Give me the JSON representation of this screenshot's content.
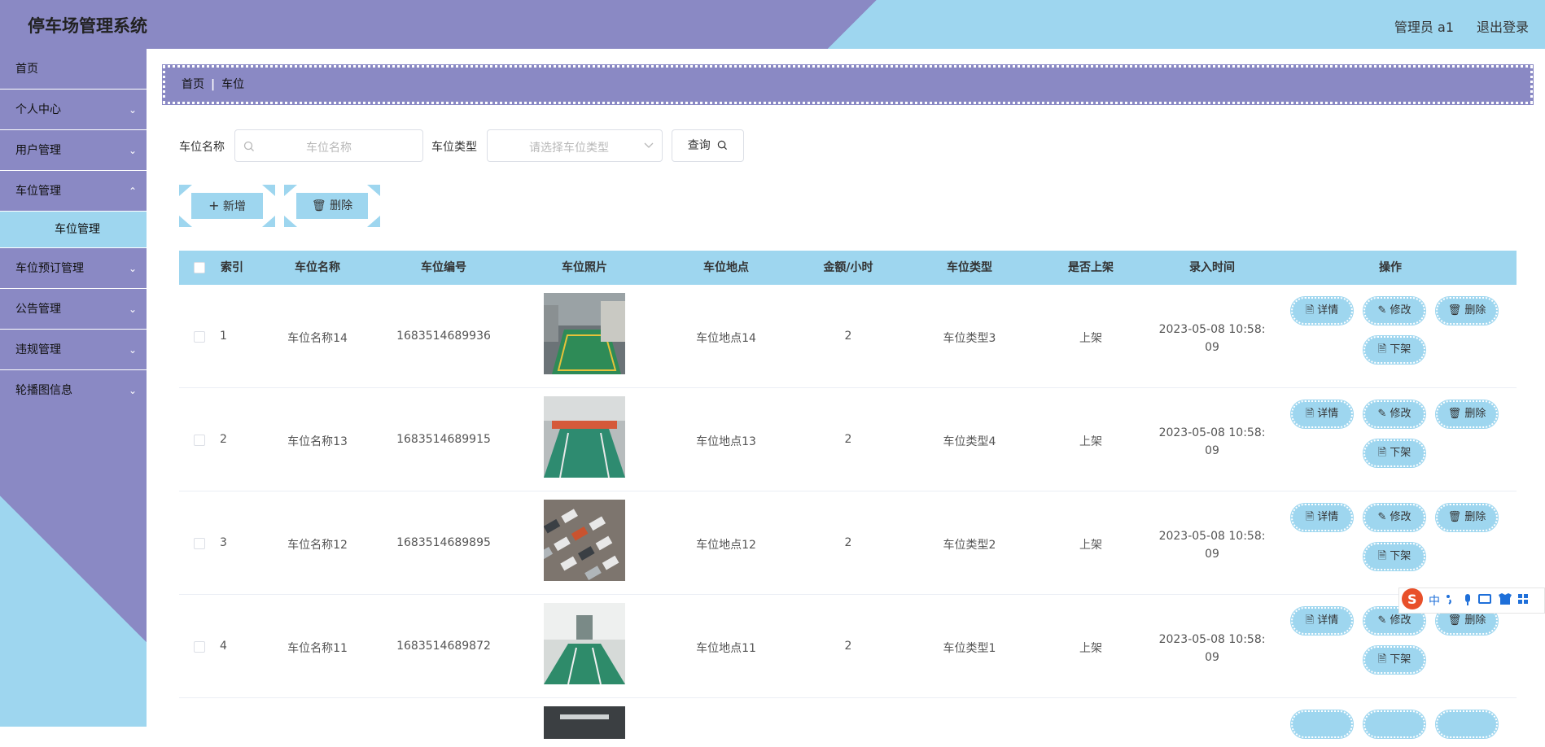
{
  "header": {
    "title": "停车场管理系统",
    "user": "管理员 a1",
    "logout": "退出登录"
  },
  "sidebar": {
    "items": [
      {
        "label": "首页"
      },
      {
        "label": "个人中心"
      },
      {
        "label": "用户管理"
      },
      {
        "label": "车位管理"
      },
      {
        "label": "车位预订管理"
      },
      {
        "label": "公告管理"
      },
      {
        "label": "违规管理"
      },
      {
        "label": "轮播图信息"
      }
    ],
    "sub_item": "车位管理"
  },
  "breadcrumb": {
    "home": "首页",
    "separator": "|",
    "current": "车位"
  },
  "search": {
    "name_label": "车位名称",
    "name_placeholder": "车位名称",
    "type_label": "车位类型",
    "type_placeholder": "请选择车位类型",
    "query_button": "查询"
  },
  "actions": {
    "add": "新增",
    "delete": "删除"
  },
  "table": {
    "headers": [
      "索引",
      "车位名称",
      "车位编号",
      "车位照片",
      "车位地点",
      "金额/小时",
      "车位类型",
      "是否上架",
      "录入时间",
      "操作"
    ],
    "rows": [
      {
        "index": "1",
        "name": "车位名称14",
        "code": "1683514689936",
        "location": "车位地点14",
        "price": "2",
        "type": "车位类型3",
        "status": "上架",
        "time_line1": "2023-05-08 10:58:",
        "time_line2": "09"
      },
      {
        "index": "2",
        "name": "车位名称13",
        "code": "1683514689915",
        "location": "车位地点13",
        "price": "2",
        "type": "车位类型4",
        "status": "上架",
        "time_line1": "2023-05-08 10:58:",
        "time_line2": "09"
      },
      {
        "index": "3",
        "name": "车位名称12",
        "code": "1683514689895",
        "location": "车位地点12",
        "price": "2",
        "type": "车位类型2",
        "status": "上架",
        "time_line1": "2023-05-08 10:58:",
        "time_line2": "09"
      },
      {
        "index": "4",
        "name": "车位名称11",
        "code": "1683514689872",
        "location": "车位地点11",
        "price": "2",
        "type": "车位类型1",
        "status": "上架",
        "time_line1": "2023-05-08 10:58:",
        "time_line2": "09"
      }
    ],
    "op_labels": {
      "detail": "详情",
      "edit": "修改",
      "delete": "删除",
      "unlist": "下架"
    }
  },
  "ime": {
    "lang": "中"
  },
  "colors": {
    "purple": "#8a89c4",
    "light_blue": "#9ed6ef",
    "floor_green": "#2e8b57"
  }
}
